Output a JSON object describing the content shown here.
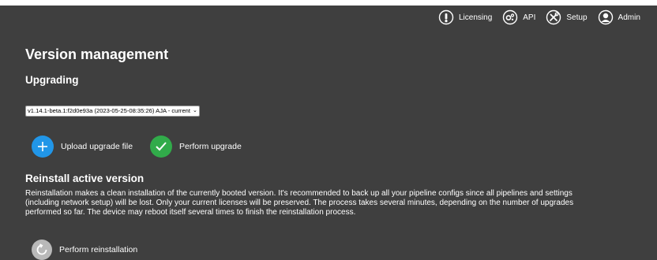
{
  "nav": {
    "items": [
      {
        "label": "Licensing",
        "icon": "licensing-icon"
      },
      {
        "label": "API",
        "icon": "api-icon"
      },
      {
        "label": "Setup",
        "icon": "setup-icon"
      },
      {
        "label": "Admin",
        "icon": "user-icon"
      }
    ]
  },
  "page": {
    "title": "Version management"
  },
  "upgrading": {
    "heading": "Upgrading",
    "selected_version": "v1.14.1-beta.1:f2d0e93a (2023-05-25-08:35:26) AJA - current",
    "upload_label": "Upload upgrade file",
    "perform_label": "Perform upgrade"
  },
  "reinstall": {
    "heading": "Reinstall active version",
    "description_lines": [
      "Reinstallation makes a clean installation of the currently booted version. It's recommended to back up all your pipeline configs since all pipelines and settings",
      "(including network setup) will be lost. Only your current licenses will be preserved. The process takes several minutes, depending on the number of upgrades",
      "performed so far. The device may reboot itself several times to finish the reinstallation process."
    ],
    "button_label": "Perform reinstallation"
  },
  "colors": {
    "background": "#3f3f3f",
    "upload_blue": "#2196e8",
    "upgrade_green": "#31ab4a",
    "reinstall_gray": "#b9b9b9"
  }
}
